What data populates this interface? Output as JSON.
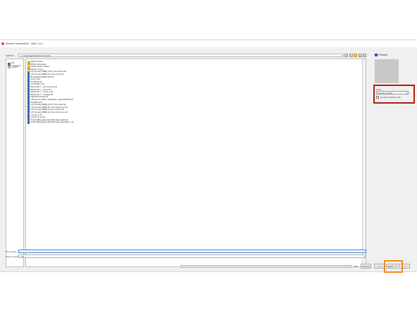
{
  "window": {
    "title": "Element Importation - Step 1 or 1"
  },
  "lookin": {
    "label": "Look in:",
    "path": "C:\\Users\\author\\Documents"
  },
  "toolbar": {
    "icons": [
      "up-folder-icon",
      "home-icon",
      "new-folder-icon",
      "list-view-icon",
      "details-view-icon"
    ]
  },
  "preview": {
    "label": "Preview",
    "checked": true
  },
  "places": [
    {
      "label": "My Computer",
      "icon": "computer-icon"
    },
    {
      "label": "author",
      "icon": "user-folder-icon"
    }
  ],
  "files": [
    {
      "name": "Blank Screen",
      "type": "folder"
    },
    {
      "name": "Editorial Recipes",
      "type": "folder"
    },
    {
      "name": "Iwllow three images",
      "type": "folder"
    },
    {
      "name": "power colony",
      "type": "folder"
    },
    {
      "name": "LR_Focused_ERNR_R1T1_Document.stl",
      "type": "file"
    },
    {
      "name": "LR_Focused_ERNR_R1_Document.stl",
      "type": "file"
    },
    {
      "name": "BracketSolidOutputsel.stl",
      "type": "file"
    },
    {
      "name": "body_1.stl",
      "type": "file"
    },
    {
      "name": "ComfertA.stl",
      "type": "file"
    },
    {
      "name": "ComfertB_1.stl",
      "type": "file"
    },
    {
      "name": "ERUS disc 1 - groove-rope.stl",
      "type": "file"
    },
    {
      "name": "ERUS disc 1 - block.stl",
      "type": "file"
    },
    {
      "name": "ERUS disc 1 - block_1.stl",
      "type": "file"
    },
    {
      "name": "ERUS disc 1 - Hedges.stl",
      "type": "file"
    },
    {
      "name": "Heat Exchanger.stl",
      "type": "file"
    },
    {
      "name": "Libered encaptors bolsballeux_Recubad019.stl",
      "type": "file"
    },
    {
      "name": "GlowPlug.stl",
      "type": "file"
    },
    {
      "name": "LR_Focused_ERNR_R1T1_Document.stl",
      "type": "file"
    },
    {
      "name": "LR_Focused_ERNR_R1_Document_acr.stl",
      "type": "file"
    },
    {
      "name": "LR_Focused_ERNR_R1_Document.stl",
      "type": "file"
    },
    {
      "name": "LR_Focused_ERNR_R1_Document_acr.stl",
      "type": "file"
    },
    {
      "name": "u-body_1.stl",
      "type": "file"
    },
    {
      "name": "u-body_1-acr.stl",
      "type": "file"
    },
    {
      "name": "ThinOutBlog_Recoded0195_Recoded0.stl",
      "type": "file"
    },
    {
      "name": "ThinOutBlog_Recoded0195_Recoded0195_1.stl",
      "type": "file"
    }
  ],
  "tools": {
    "label": "Tools",
    "dropdown_value": "Choose a Tooly",
    "checkbox_label": "Convert solids to ent."
  },
  "filename": {
    "label": "File name:",
    "value": ""
  },
  "filetype": {
    "label": "Files of type:",
    "value": "*.stl"
  },
  "progress": {
    "percent_label": "0%",
    "fraction": 0
  },
  "buttons": {
    "cancel": "Cancel",
    "back": "< Back",
    "next": "Next >",
    "finish": "Finish"
  },
  "colors": {
    "highlight_red": "#b01e10",
    "highlight_orange": "#f08c1a",
    "accent_blue": "#2a63c7"
  }
}
